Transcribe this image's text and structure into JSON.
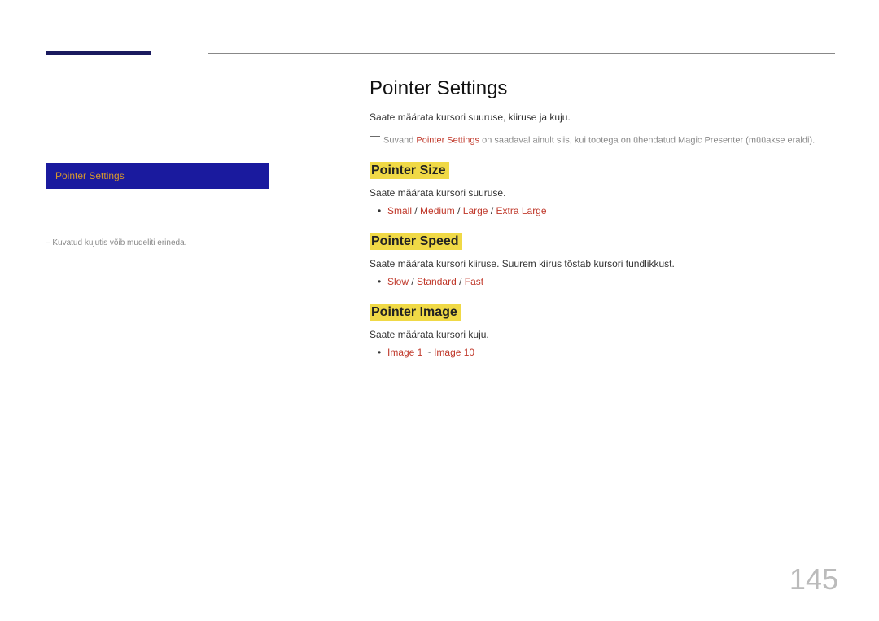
{
  "sidebar": {
    "menu_label": "Pointer Settings",
    "note": "– Kuvatud kujutis võib mudeliti erineda."
  },
  "main": {
    "title": "Pointer Settings",
    "intro": "Saate määrata kursori suuruse, kiiruse ja kuju.",
    "note_prefix": "Suvand ",
    "note_keyword": "Pointer Settings",
    "note_suffix": " on saadaval ainult siis, kui tootega on ühendatud Magic Presenter (müüakse eraldi).",
    "sections": {
      "size": {
        "heading": "Pointer Size",
        "intro": "Saate määrata kursori suuruse.",
        "opts": [
          "Small",
          "Medium",
          "Large",
          "Extra Large"
        ]
      },
      "speed": {
        "heading": "Pointer Speed",
        "intro": "Saate määrata kursori kiiruse. Suurem kiirus tõstab kursori tundlikkust.",
        "opts": [
          "Slow",
          "Standard",
          "Fast"
        ]
      },
      "image": {
        "heading": "Pointer Image",
        "intro": "Saate määrata kursori kuju.",
        "range_from": "Image 1",
        "range_to": "Image 10"
      }
    }
  },
  "page_number": "145"
}
